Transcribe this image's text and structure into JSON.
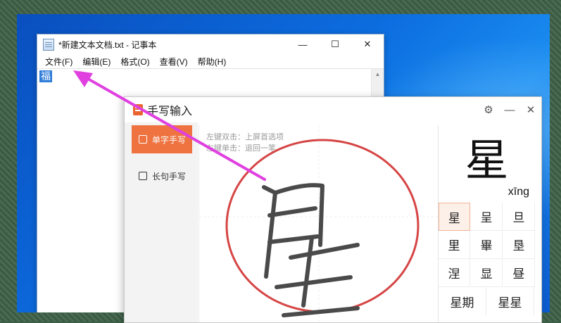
{
  "notepad": {
    "title": "*新建文本文档.txt - 记事本",
    "controls": {
      "minimize": "—",
      "maximize": "☐",
      "close": "✕"
    },
    "menu": [
      "文件(F)",
      "编辑(E)",
      "格式(O)",
      "查看(V)",
      "帮助(H)"
    ],
    "content": "福"
  },
  "handwriting": {
    "title": "手写输入",
    "controls": {
      "settings": "⚙",
      "minimize": "—",
      "close": "✕"
    },
    "modes": [
      {
        "label": "单字手写",
        "active": true
      },
      {
        "label": "长句手写",
        "active": false
      }
    ],
    "hints": [
      "左键双击：上屏首选项",
      "左键单击：退回一笔"
    ],
    "drawn_character": "星",
    "preview": {
      "character": "星",
      "pinyin": "xīng"
    },
    "candidates": [
      "星",
      "呈",
      "旦",
      "里",
      "畢",
      "垦",
      "涅",
      "显",
      "昼"
    ],
    "phrases": [
      "星期",
      "星星"
    ]
  },
  "colors": {
    "accent": "#ee7341",
    "arrow": "#e040e0",
    "circle": "#d64545",
    "selection": "#2f7bd8"
  }
}
